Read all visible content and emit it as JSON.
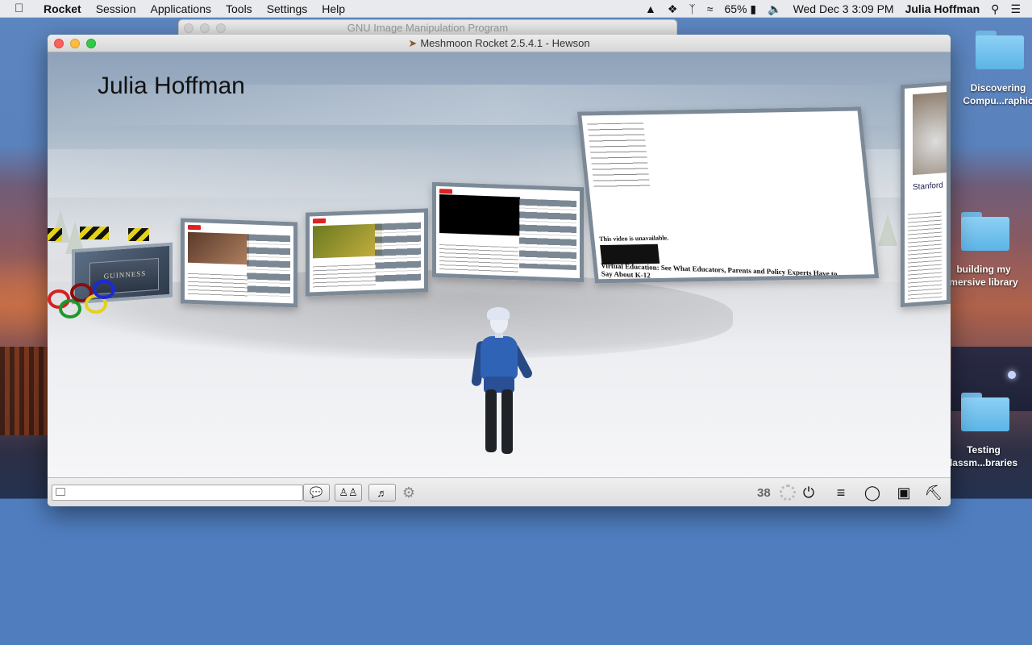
{
  "menubar": {
    "app_name": "Rocket",
    "menus": [
      "Session",
      "Applications",
      "Tools",
      "Settings",
      "Help"
    ],
    "battery": "65%",
    "datetime": "Wed Dec 3  3:09 PM",
    "username": "Julia Hoffman"
  },
  "background_window": {
    "title": "GNU Image Manipulation Program"
  },
  "main_window": {
    "title": "Meshmoon Rocket 2.5.4.1 - Hewson"
  },
  "viewport": {
    "avatar_name_overlay": "Julia Hoffman",
    "sign_text": "GUINNESS",
    "video_unavailable_text": "This video is unavailable.",
    "video_caption": "Virtual Education: See What Educators, Parents and Policy Experts Have to Say About K-12",
    "right_panel_header": "Stanford",
    "ring_colors": [
      "#d62020",
      "#1a9a2a",
      "#8a0d0d",
      "#e3d21a",
      "#1a2ad6"
    ]
  },
  "toolbar": {
    "chat_placeholder": "",
    "fps": "38"
  },
  "desktop_icons": [
    {
      "label_line1": "Discovering",
      "label_line2": "Compu...raphic"
    },
    {
      "label_line1": "building my",
      "label_line2": "mersive library"
    },
    {
      "label_line1": "Testing",
      "label_line2": "lassm...braries"
    }
  ],
  "colors": {
    "desktop_blue": "#4f7dbe",
    "avatar_shirt": "#2f63b5",
    "folder": "#5cb4e6"
  }
}
